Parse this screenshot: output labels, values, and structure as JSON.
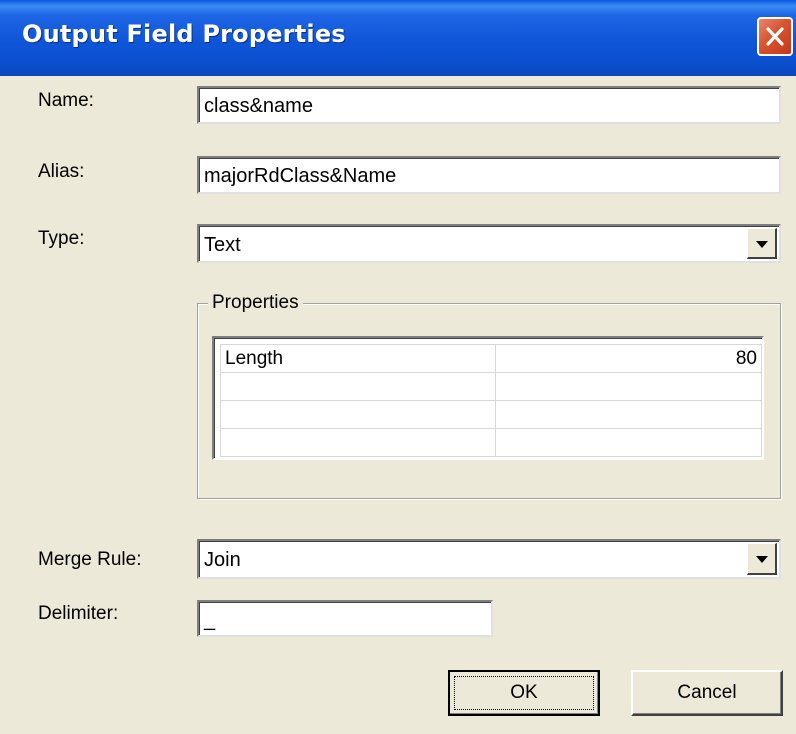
{
  "window": {
    "title": "Output Field Properties"
  },
  "fields": {
    "name_label": "Name:",
    "name_value": "class&name",
    "alias_label": "Alias:",
    "alias_value": "majorRdClass&Name",
    "type_label": "Type:",
    "type_value": "Text",
    "merge_label": "Merge Rule:",
    "merge_value": "Join",
    "delimiter_label": "Delimiter:",
    "delimiter_value": "_"
  },
  "properties": {
    "legend": "Properties",
    "rows": [
      {
        "key": "Length",
        "value": "80"
      },
      {
        "key": "",
        "value": ""
      },
      {
        "key": "",
        "value": ""
      },
      {
        "key": "",
        "value": ""
      }
    ]
  },
  "buttons": {
    "ok": "OK",
    "cancel": "Cancel"
  },
  "colors": {
    "face": "#ECE9D8",
    "titlebar": "#0F55D8",
    "close": "#D8532F"
  },
  "icons": {
    "close": "close-icon",
    "dropdown": "chevron-down-icon"
  }
}
